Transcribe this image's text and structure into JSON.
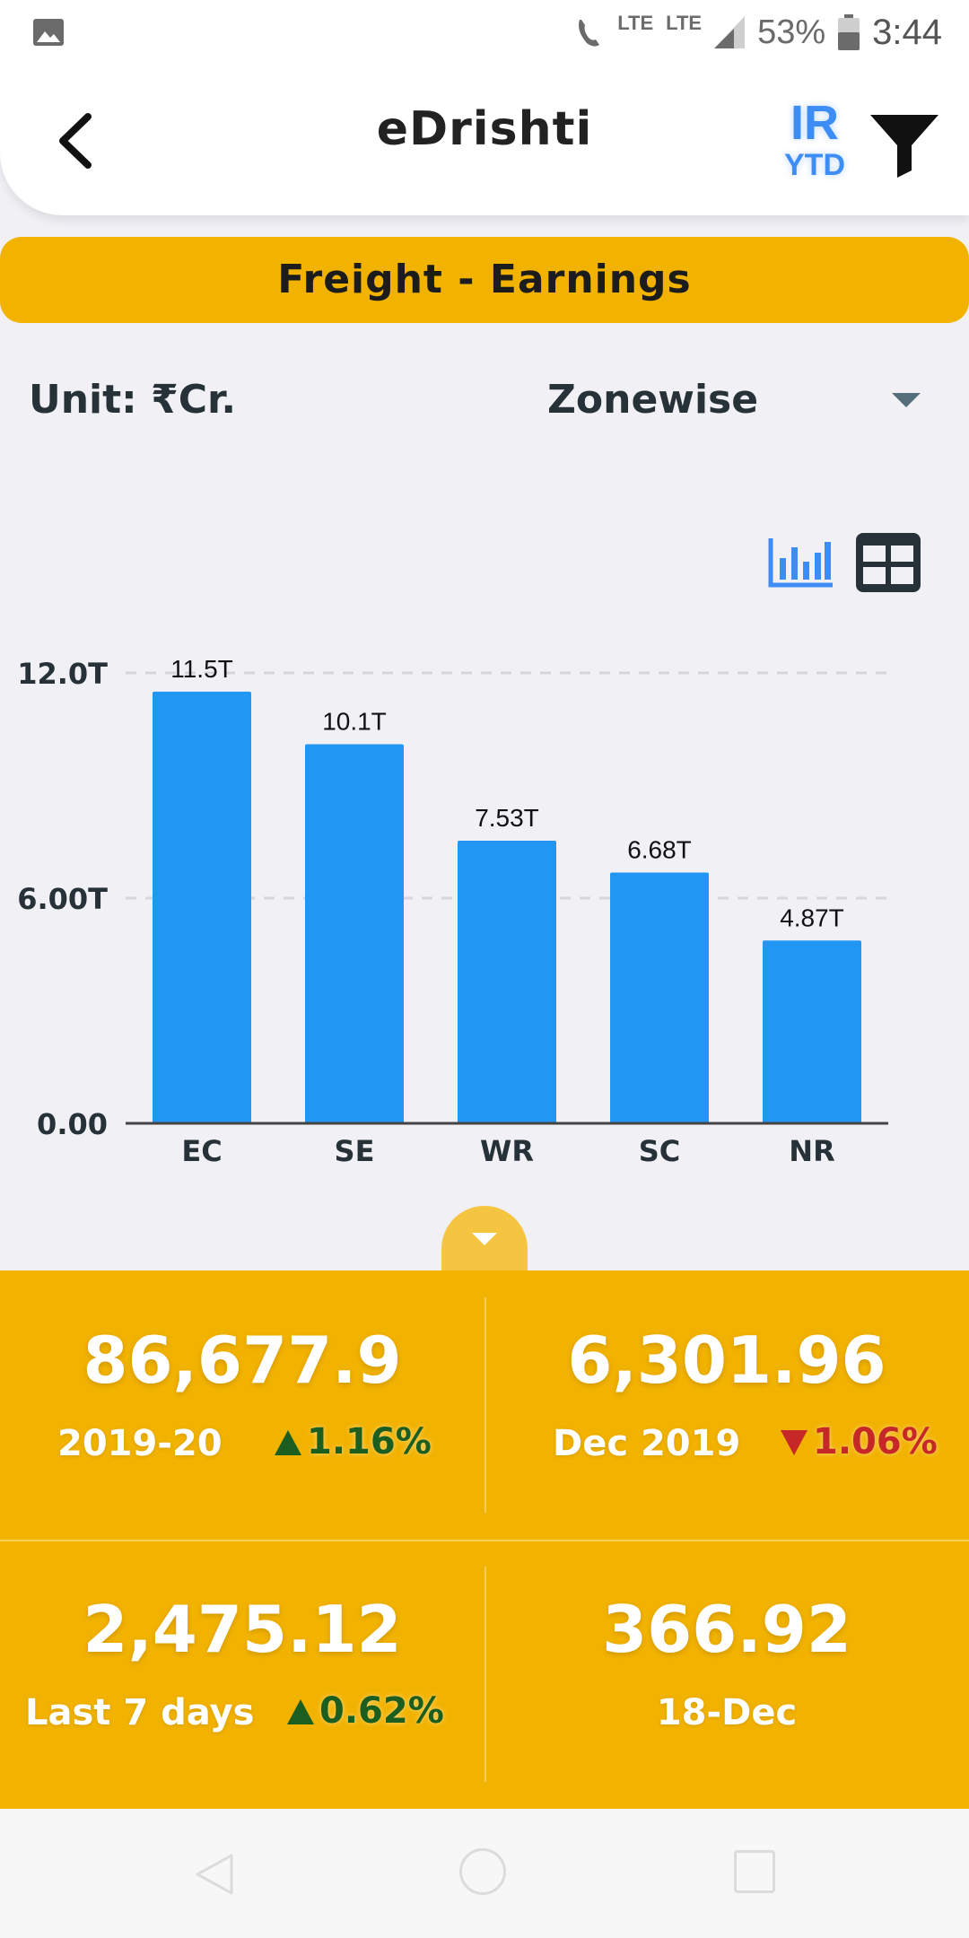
{
  "status_bar": {
    "network_1": "LTE",
    "network_2": "LTE",
    "battery": "53%",
    "time": "3:44"
  },
  "header": {
    "title": "eDrishti",
    "scope_label": "IR",
    "period_label": "YTD",
    "icons": [
      "back-arrow-icon",
      "filter-icon"
    ]
  },
  "banner": {
    "title": "Freight - Earnings"
  },
  "controls": {
    "unit_label": "Unit: ₹Cr.",
    "grouping_selected": "Zonewise",
    "view_icons": [
      "bar-chart-icon",
      "table-view-icon"
    ]
  },
  "chart_data": {
    "type": "bar",
    "categories": [
      "EC",
      "SE",
      "WR",
      "SC",
      "NR"
    ],
    "values": [
      11.5,
      10.1,
      7.53,
      6.68,
      4.87
    ],
    "value_unit": "T",
    "data_labels": [
      "11.5T",
      "10.1T",
      "7.53T",
      "6.68T",
      "4.87T"
    ],
    "ytick_labels": [
      "0.00",
      "6.00T",
      "12.0T"
    ],
    "ytick_values": [
      0,
      6,
      12
    ],
    "ylim": [
      0,
      12
    ],
    "grid": "horizontal dashed",
    "bar_color": "#2196f3",
    "title": "",
    "xlabel": "",
    "ylabel": ""
  },
  "stats": {
    "cells": [
      {
        "value": "86,677.9",
        "label": "2019-20",
        "change": "1.16%",
        "direction": "up"
      },
      {
        "value": "6,301.96",
        "label": "Dec 2019",
        "change": "1.06%",
        "direction": "down"
      },
      {
        "value": "2,475.12",
        "label": "Last 7 days",
        "change": "0.62%",
        "direction": "up"
      },
      {
        "value": "366.92",
        "label": "18-Dec"
      }
    ]
  },
  "colors": {
    "accent_yellow": "#f2b200",
    "bar_blue": "#2196f3",
    "ir_blue": "#3d8df5",
    "up_green": "#1b5e20",
    "down_red": "#c62828"
  }
}
